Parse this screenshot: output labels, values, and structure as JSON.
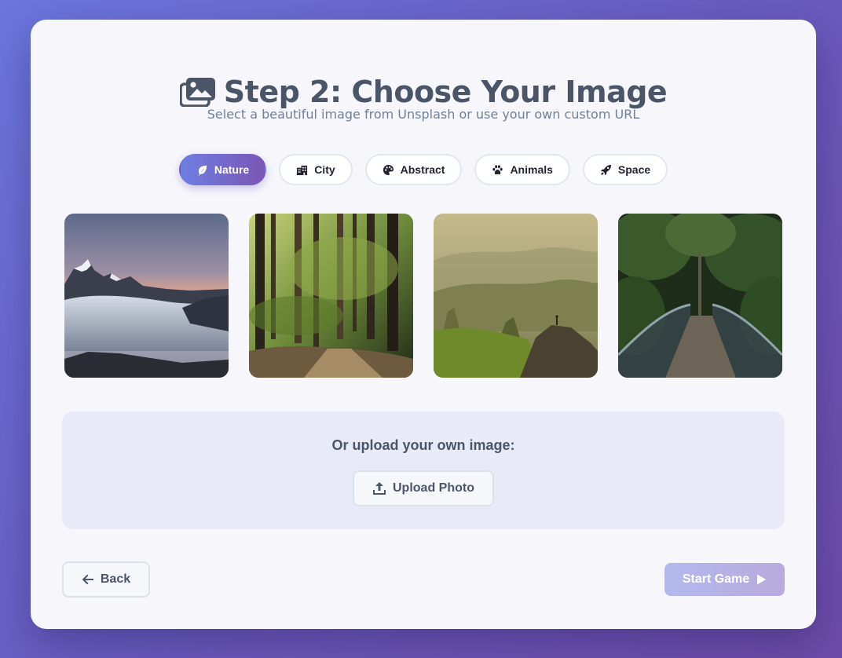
{
  "header": {
    "title": "Step 2: Choose Your Image",
    "title_icon": "images-icon",
    "subtitle": "Select a beautiful image from Unsplash or use your own custom URL"
  },
  "categories": [
    {
      "label": "Nature",
      "icon": "leaf-icon",
      "active": true
    },
    {
      "label": "City",
      "icon": "city-icon",
      "active": false
    },
    {
      "label": "Abstract",
      "icon": "palette-icon",
      "active": false
    },
    {
      "label": "Animals",
      "icon": "paw-icon",
      "active": false
    },
    {
      "label": "Space",
      "icon": "rocket-icon",
      "active": false
    }
  ],
  "gallery": [
    {
      "subject": "snowy mountain peaks above a sea of clouds at sunset"
    },
    {
      "subject": "forest path between tall trees"
    },
    {
      "subject": "person standing on a rock above misty green hills"
    },
    {
      "subject": "wooden footbridge in a dense jungle"
    }
  ],
  "upload": {
    "label": "Or upload your own image:",
    "button_label": "Upload Photo",
    "button_icon": "upload-icon"
  },
  "footer": {
    "back_label": "Back",
    "back_icon": "arrow-left-icon",
    "start_label": "Start Game",
    "start_icon": "play-icon",
    "start_enabled": false
  },
  "colors": {
    "accent_start": "#6f7ee2",
    "accent_end": "#7a55b4",
    "text_primary": "#4a5568",
    "text_muted": "#718096"
  }
}
